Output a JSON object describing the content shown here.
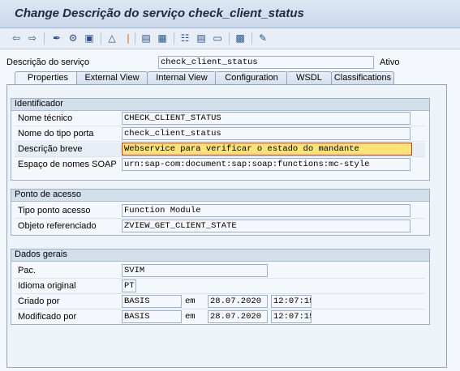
{
  "window": {
    "title": "Change Descrição do serviço check_client_status"
  },
  "toolbar": {
    "icons": [
      "back-icon",
      "forward-icon",
      "edit-toggle-icon",
      "other-object-icon",
      "display-change-icon",
      "where-used-icon",
      "activate-icon",
      "object-list-icon",
      "navigation-window-icon",
      "hierarchy-icon",
      "layout-icon",
      "info-icon",
      "print-icon",
      "help-icon"
    ]
  },
  "header": {
    "label": "Descrição do serviço",
    "value": "check_client_status",
    "status": "Ativo"
  },
  "tabs": [
    "Properties",
    "External View",
    "Internal View",
    "Configuration",
    "WSDL",
    "Classifications"
  ],
  "identificador": {
    "title": "Identificador",
    "rows": [
      {
        "label": "Nome técnico",
        "value": "CHECK_CLIENT_STATUS"
      },
      {
        "label": "Nome do tipo porta",
        "value": "check_client_status"
      },
      {
        "label": "Descrição breve",
        "value": "Webservice para verificar o estado do mandante"
      },
      {
        "label": "Espaço de nomes SOAP",
        "value": "urn:sap-com:document:sap:soap:functions:mc-style"
      }
    ]
  },
  "ponto": {
    "title": "Ponto de acesso",
    "rows": [
      {
        "label": "Tipo ponto acesso",
        "value": "Function Module"
      },
      {
        "label": "Objeto referenciado",
        "value": "ZVIEW_GET_CLIENT_STATE"
      }
    ]
  },
  "dados": {
    "title": "Dados gerais",
    "pac_label": "Pac.",
    "pac_value": "SVIM",
    "idioma_label": "Idioma original",
    "idioma_value": "PT",
    "criado_label": "Criado por",
    "criado_user": "BASIS",
    "criado_em": "em",
    "criado_date": "28.07.2020",
    "criado_time": "12:07:15",
    "mod_label": "Modificado por",
    "mod_user": "BASIS",
    "mod_em": "em",
    "mod_date": "28.07.2020",
    "mod_time": "12:07:15"
  },
  "colors": {
    "titlebar": "#c9d8ea",
    "highlight_field": "#fde27a",
    "panel": "#eef3f9"
  }
}
